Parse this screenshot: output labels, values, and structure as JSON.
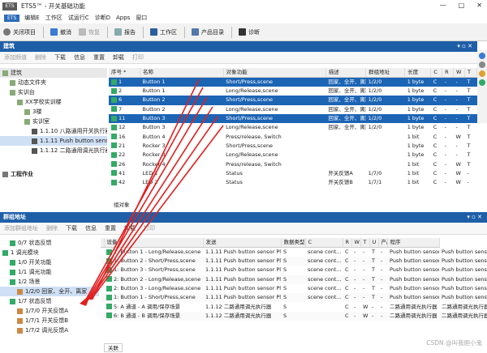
{
  "window": {
    "logo": "ETS",
    "title": "ETS5™ - 开关基础功能",
    "controls": [
      "—",
      "□",
      "✕"
    ]
  },
  "menu": {
    "logo": "ETS",
    "items": [
      "编辑E",
      "工作区",
      "试运行C",
      "诊断D",
      "Apps",
      "窗口"
    ]
  },
  "toolbar": {
    "items": [
      "关闭项目",
      "撤消",
      "恢复",
      "报告",
      "工作区",
      "产品目录",
      "诊断"
    ]
  },
  "top_panel": {
    "title": "建筑",
    "controls": "▾ ▫ ✕",
    "subtoolbar": [
      "添加频道",
      "删除",
      "下载",
      "信息",
      "重置",
      "卸载",
      "打印"
    ],
    "tree": [
      {
        "label": "建筑",
        "indent": 0,
        "header": true
      },
      {
        "label": "动态文件夹",
        "indent": 1
      },
      {
        "label": "实训台",
        "indent": 1
      },
      {
        "label": "XX学校实训楼",
        "indent": 2
      },
      {
        "label": "3楼",
        "indent": 3
      },
      {
        "label": "实训室",
        "indent": 3
      },
      {
        "label": "1.1.10 八路通用开关执行器",
        "indent": 4
      },
      {
        "label": "1.1.11 Push button sensor P...",
        "indent": 4,
        "selected": true
      },
      {
        "label": "1.1.12 二路通用调光执行器",
        "indent": 4
      }
    ],
    "tree_footer": "工程作业",
    "columns": [
      "序号 *",
      "名称",
      "对象功能",
      "描述",
      "群组地址",
      "长度",
      "C",
      "R",
      "W",
      "T"
    ],
    "rows": [
      {
        "n": "1",
        "name": "Button 1",
        "func": "Short/Press,scene",
        "desc": "回家、全开、离家",
        "ga": "1/2/0",
        "len": "1 byte",
        "c": "C",
        "r": "-",
        "w": "-",
        "t": "T",
        "sel": true
      },
      {
        "n": "2",
        "name": "Button 1",
        "func": "Long/Release,scene",
        "desc": "回家、全开、离家",
        "ga": "1/2/0",
        "len": "1 byte",
        "c": "C",
        "r": "-",
        "w": "-",
        "t": "T"
      },
      {
        "n": "6",
        "name": "Button 2",
        "func": "Short/Press,scene",
        "desc": "回家、全开、离家",
        "ga": "1/2/0",
        "len": "1 byte",
        "c": "C",
        "r": "-",
        "w": "-",
        "t": "T",
        "sel": true
      },
      {
        "n": "7",
        "name": "Button 2",
        "func": "Long/Release,scene",
        "desc": "回家、全开、离家",
        "ga": "1/2/0",
        "len": "1 byte",
        "c": "C",
        "r": "-",
        "w": "-",
        "t": "T"
      },
      {
        "n": "11",
        "name": "Button 3",
        "func": "Short/Press,scene",
        "desc": "回家、全开、离家",
        "ga": "1/2/0",
        "len": "1 byte",
        "c": "C",
        "r": "-",
        "w": "-",
        "t": "T",
        "sel": true
      },
      {
        "n": "12",
        "name": "Button 3",
        "func": "Long/Release,scene",
        "desc": "回家、全开、离家",
        "ga": "1/2/0",
        "len": "1 byte",
        "c": "C",
        "r": "-",
        "w": "-",
        "t": "T"
      },
      {
        "n": "16",
        "name": "Button 4",
        "func": "Press/release, Switch",
        "desc": "",
        "ga": "",
        "len": "1 bit",
        "c": "C",
        "r": "-",
        "w": "W",
        "t": "T"
      },
      {
        "n": "21",
        "name": "Rocker 3",
        "func": "Short/Press,scene",
        "desc": "",
        "ga": "",
        "len": "1 byte",
        "c": "C",
        "r": "-",
        "w": "-",
        "t": "T"
      },
      {
        "n": "22",
        "name": "Rocker 3",
        "func": "Long/Release,scene",
        "desc": "",
        "ga": "",
        "len": "1 byte",
        "c": "C",
        "r": "-",
        "w": "-",
        "t": "T"
      },
      {
        "n": "26",
        "name": "Rocker 4",
        "func": "Press/release, Switch",
        "desc": "",
        "ga": "",
        "len": "1 bit",
        "c": "C",
        "r": "-",
        "w": "W",
        "t": "T"
      },
      {
        "n": "41",
        "name": "LED 1",
        "func": "Status",
        "desc": "开关反馈A",
        "ga": "1/7/0",
        "len": "1 bit",
        "c": "C",
        "r": "-",
        "w": "W",
        "t": "-"
      },
      {
        "n": "42",
        "name": "LED 2",
        "func": "Status",
        "desc": "开关反馈B",
        "ga": "1/7/1",
        "len": "1 bit",
        "c": "C",
        "r": "-",
        "w": "W",
        "t": "-"
      }
    ],
    "footer_tab": "组对象"
  },
  "bottom_panel": {
    "title": "群组地址",
    "controls": "▾ ▫ ✕",
    "subtoolbar": [
      "添加群组地址",
      "删除",
      "下载",
      "信息",
      "重置",
      "卸载",
      "打印"
    ],
    "tree": [
      {
        "label": "0/7 状态反馈",
        "indent": 1
      },
      {
        "label": "1 调光模块",
        "indent": 0
      },
      {
        "label": "1/0 开关功能",
        "indent": 1
      },
      {
        "label": "1/1 调光功能",
        "indent": 1
      },
      {
        "label": "1/2 场景",
        "indent": 1
      },
      {
        "label": "1/2/0 回家、全开、离家",
        "indent": 2,
        "selected": true
      },
      {
        "label": "1/7 状态反馈",
        "indent": 1
      },
      {
        "label": "1/7/0 开关反馈A",
        "indent": 2
      },
      {
        "label": "1/7/1 开关反馈B",
        "indent": 2
      },
      {
        "label": "1/7/2 调光反馈A",
        "indent": 2
      }
    ],
    "columns": [
      "",
      "设备 *",
      "发送",
      "数据类型",
      "C",
      "R",
      "W",
      "T",
      "U",
      "产品",
      "程序"
    ],
    "rows": [
      {
        "name": "1: Button 1 - Long/Release,scene",
        "dev": "1.1.11 Push button sensor Plus...",
        "send": "S",
        "type": "scene cont...",
        "c": "C",
        "r": "-",
        "w": "-",
        "t": "T",
        "u": "-",
        "prod": "Push button sensor...",
        "prog": "Push button sensor"
      },
      {
        "name": "1: Button 2 - Short/Press,scene",
        "dev": "1.1.11 Push button sensor Plus...",
        "send": "S",
        "type": "scene cont...",
        "c": "C",
        "r": "-",
        "w": "-",
        "t": "T",
        "u": "-",
        "prod": "Push button sensor...",
        "prog": "Push button sensor"
      },
      {
        "name": "1: Button 3 - Short/Press,scene",
        "dev": "1.1.11 Push button sensor Plus...",
        "send": "S",
        "type": "scene cont...",
        "c": "C",
        "r": "-",
        "w": "-",
        "t": "T",
        "u": "-",
        "prod": "Push button sensor...",
        "prog": "Push button sensor"
      },
      {
        "name": "2: Button 2 - Long/Release,scene",
        "dev": "1.1.11 Push button sensor Plus...",
        "send": "S",
        "type": "scene cont...",
        "c": "C",
        "r": "-",
        "w": "-",
        "t": "T",
        "u": "-",
        "prod": "Push button sensor...",
        "prog": "Push button sensor"
      },
      {
        "name": "2: Button 3 - Long/Release,scene",
        "dev": "1.1.11 Push button sensor Plus...",
        "send": "S",
        "type": "scene cont...",
        "c": "C",
        "r": "-",
        "w": "-",
        "t": "T",
        "u": "-",
        "prod": "Push button sensor...",
        "prog": "Push button sensor"
      },
      {
        "name": "1: Button 1 - Short/Press,scene",
        "dev": "1.1.11 Push button sensor Plus...",
        "send": "S",
        "type": "scene cont...",
        "c": "C",
        "r": "-",
        "w": "-",
        "t": "T",
        "u": "-",
        "prod": "Push button sensor...",
        "prog": "Push button sensor"
      },
      {
        "name": "5: A 通道 - A 调用/保存场景",
        "dev": "1.1.12 二路通用调光执行器",
        "send": "S",
        "type": "",
        "c": "C",
        "r": "-",
        "w": "W",
        "t": "-",
        "u": "-",
        "prod": "二路通用调光执行器",
        "prog": "二路通用调光执行器"
      },
      {
        "name": "6: B 通道 - B 调用/保存场景",
        "dev": "1.1.12 二路通用调光执行器",
        "send": "S",
        "type": "",
        "c": "C",
        "r": "-",
        "w": "W",
        "t": "-",
        "u": "-",
        "prod": "二路通用调光执行器",
        "prog": "二路通用调光执行器"
      }
    ],
    "footer_tab": "关联"
  },
  "watermark": "CSDN @叫我胆小鬼",
  "colors": {
    "accent": "#1e5fa8",
    "selection": "#1c64b4",
    "arrow": "#e02020"
  }
}
